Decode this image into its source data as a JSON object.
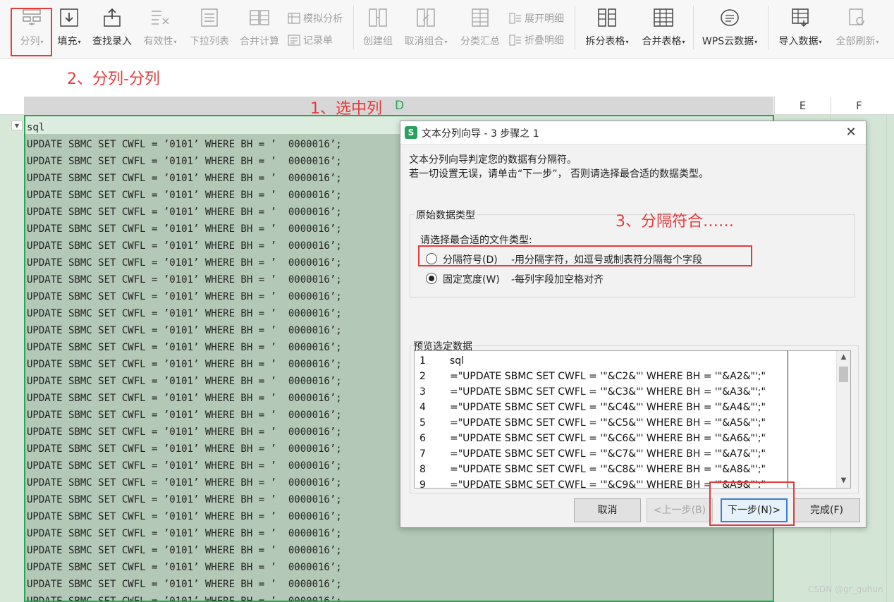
{
  "ribbon": {
    "buttons": [
      {
        "id": "split",
        "label": "分列",
        "dropdown": true,
        "disabled": true,
        "icon": "text-to-columns-icon"
      },
      {
        "id": "fill",
        "label": "填充",
        "dropdown": true,
        "disabled": false,
        "icon": "fill-down-icon"
      },
      {
        "id": "lookup",
        "label": "查找录入",
        "dropdown": false,
        "disabled": false,
        "icon": "lookup-entry-icon"
      },
      {
        "id": "validity",
        "label": "有效性",
        "dropdown": true,
        "disabled": true,
        "icon": "data-validation-icon"
      },
      {
        "id": "dropdown-list",
        "label": "下拉列表",
        "dropdown": false,
        "disabled": true,
        "icon": "dropdown-list-icon"
      },
      {
        "id": "consolidate",
        "label": "合并计算",
        "dropdown": false,
        "disabled": true,
        "icon": "consolidate-icon"
      },
      {
        "id": "group",
        "label": "创建组",
        "dropdown": false,
        "disabled": true,
        "icon": "group-icon"
      },
      {
        "id": "ungroup",
        "label": "取消组合",
        "dropdown": true,
        "disabled": true,
        "icon": "ungroup-icon"
      },
      {
        "id": "subtotal",
        "label": "分类汇总",
        "dropdown": false,
        "disabled": true,
        "icon": "subtotal-icon"
      },
      {
        "id": "split-table",
        "label": "拆分表格",
        "dropdown": true,
        "disabled": false,
        "icon": "split-table-icon"
      },
      {
        "id": "merge-table",
        "label": "合并表格",
        "dropdown": true,
        "disabled": false,
        "icon": "merge-table-icon"
      },
      {
        "id": "wps-cloud",
        "label": "WPS云数据",
        "dropdown": true,
        "disabled": false,
        "icon": "cloud-data-icon"
      },
      {
        "id": "import",
        "label": "导入数据",
        "dropdown": true,
        "disabled": false,
        "icon": "import-data-icon"
      },
      {
        "id": "refresh-all",
        "label": "全部刷新",
        "dropdown": true,
        "disabled": true,
        "icon": "refresh-all-icon"
      }
    ],
    "small_buttons": {
      "what_if": "模拟分析",
      "record_form": "记录单",
      "show_detail": "展开明细",
      "hide_detail": "折叠明细"
    }
  },
  "annotations": {
    "step1": "1、选中列",
    "step2": "2、分列-分列",
    "step3": "3、分隔符合……"
  },
  "sheet": {
    "columns": [
      "D",
      "E",
      "F"
    ],
    "header_cell": "sql",
    "row_text": "UPDATE SBMC SET CWFL = ’0101’ WHERE BH = ’  0000016’;",
    "row_count": 28
  },
  "dialog": {
    "title": "文本分列向导 - 3 步骤之 1",
    "logo": "S",
    "intro_line1": "文本分列向导判定您的数据有分隔符。",
    "intro_line2": "若一切设置无误，请单击“下一步”， 否则请选择最合适的数据类型。",
    "group_label": "原始数据类型",
    "prompt": "请选择最合适的文件类型:",
    "options": [
      {
        "label": "分隔符号(D)",
        "desc": "-用分隔字符，如逗号或制表符分隔每个字段",
        "checked": false
      },
      {
        "label": "固定宽度(W)",
        "desc": "-每列字段加空格对齐",
        "checked": true
      }
    ],
    "preview_label": "预览选定数据",
    "preview_rows": [
      {
        "num": "1",
        "text": "sql"
      },
      {
        "num": "2",
        "text": "=\"UPDATE SBMC SET CWFL = '\"&C2&\"' WHERE BH = '\"&A2&\"';\""
      },
      {
        "num": "3",
        "text": "=\"UPDATE SBMC SET CWFL = '\"&C3&\"' WHERE BH = '\"&A3&\"';\""
      },
      {
        "num": "4",
        "text": "=\"UPDATE SBMC SET CWFL = '\"&C4&\"' WHERE BH = '\"&A4&\"';\""
      },
      {
        "num": "5",
        "text": "=\"UPDATE SBMC SET CWFL = '\"&C5&\"' WHERE BH = '\"&A5&\"';\""
      },
      {
        "num": "6",
        "text": "=\"UPDATE SBMC SET CWFL = '\"&C6&\"' WHERE BH = '\"&A6&\"';\""
      },
      {
        "num": "7",
        "text": "=\"UPDATE SBMC SET CWFL = '\"&C7&\"' WHERE BH = '\"&A7&\"';\""
      },
      {
        "num": "8",
        "text": "=\"UPDATE SBMC SET CWFL = '\"&C8&\"' WHERE BH = '\"&A8&\"';\""
      },
      {
        "num": "9",
        "text": "=\"UPDATE SBMC SET CWFL = '\"&C9&\"' WHERE BH = '\"&A9&\"';\""
      }
    ],
    "buttons": {
      "cancel": "取消",
      "back": "<上一步(B)",
      "next": "下一步(N)>",
      "finish": "完成(F)"
    }
  },
  "watermark": "CSDN @gr_guhun",
  "colors": {
    "accent_red": "#e83a3a",
    "selection_green": "#2aa35a",
    "selected_fill": "#b3c8b6"
  }
}
